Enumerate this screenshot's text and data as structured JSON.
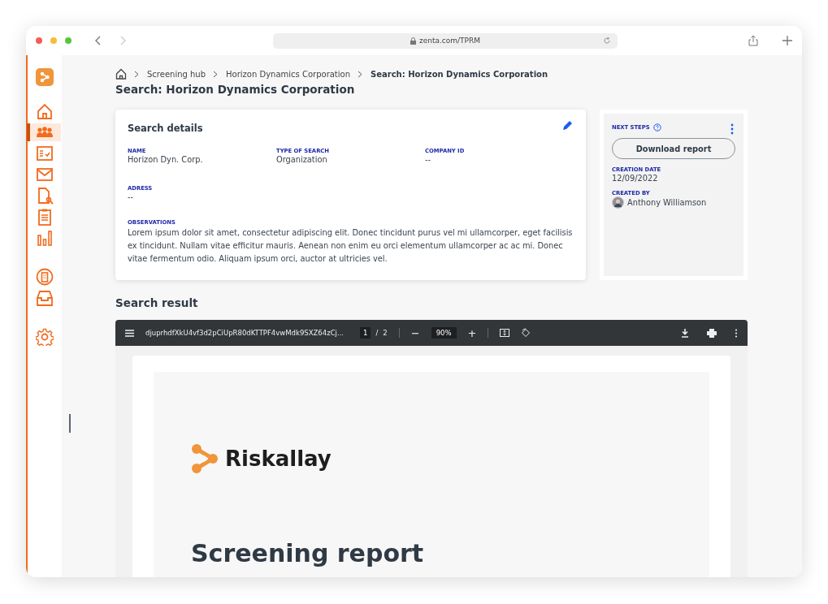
{
  "browser": {
    "url": "zenta.com/TPRM"
  },
  "sidebar": {
    "items": [
      {
        "selected": false
      },
      {
        "selected": true
      },
      {
        "selected": false
      },
      {
        "selected": false
      },
      {
        "selected": false
      },
      {
        "selected": false
      },
      {
        "selected": false
      },
      {
        "selected": false
      },
      {
        "selected": false
      },
      {
        "selected": false
      }
    ]
  },
  "breadcrumb": [
    {
      "label": "Screening hub",
      "current": false
    },
    {
      "label": "Horizon Dynamics Corporation",
      "current": false
    },
    {
      "label": "Search: Horizon Dynamics Corporation",
      "current": true
    }
  ],
  "page_title": "Search: Horizon Dynamics Corporation",
  "search_details": {
    "title": "Search details",
    "fields": [
      {
        "label": "NAME",
        "value": "Horizon Dyn. Corp."
      },
      {
        "label": "TYPE OF SEARCH",
        "value": "Organization"
      },
      {
        "label": "COMPANY ID",
        "value": "--"
      },
      {
        "label": "ADRESS",
        "value": "--"
      }
    ],
    "observations": {
      "label": "OBSERVATIONS",
      "value": "Lorem ipsum dolor sit amet, consectetur adipiscing elit. Donec tincidunt purus vel mi ullamcorper, eget facilisis ex tincidunt. Nullam vitae efficitur mauris. Aenean non enim eu orci elementum ullamcorper ac ac mi. Donec vitae fermentum odio. Aliquam ipsum orci, auctor at ultricies vel."
    }
  },
  "next_steps": {
    "title": "NEXT STEPS",
    "button": "Download report",
    "creation_date_label": "CREATION DATE",
    "creation_date": "12/09/2022",
    "created_by_label": "CREATED BY",
    "created_by": "Anthony Williamson"
  },
  "search_result": {
    "title": "Search result",
    "viewer": {
      "file_name": "djuprhdfXkU4vf3d2pCiUpR80dKTTPF4vwMdk9SXZ64zCj...",
      "page": "1",
      "page_separator": "/",
      "pages": "2",
      "zoom": "90%",
      "minus": "−",
      "plus": "+"
    },
    "document": {
      "brand": "Riskallay",
      "heading": "Screening report"
    }
  }
}
